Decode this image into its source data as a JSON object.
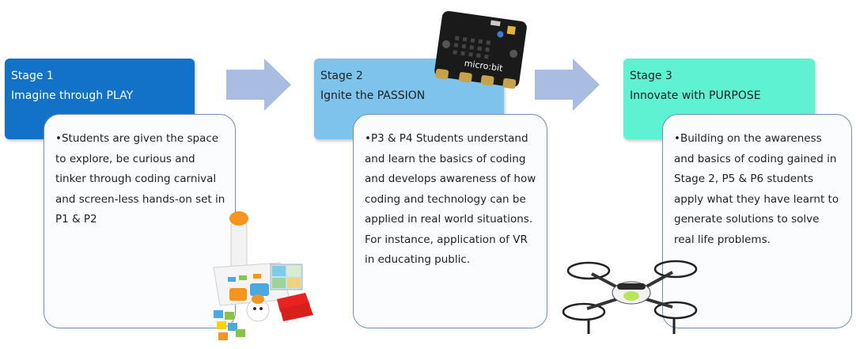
{
  "stages": [
    {
      "title": "Stage 1",
      "subtitle": "Imagine through PLAY",
      "header_color": "#1172c8",
      "body": "•Students are given the space to explore, be curious and tinker through coding carnival and screen-less hands-on set in P1 & P2"
    },
    {
      "title": "Stage 2",
      "subtitle": "Ignite the PASSION",
      "header_color": "#7ec3ec",
      "body": "•P3 & P4 Students understand and learn the basics of coding and develops awareness of how coding and technology can be applied in real world situations. For instance, application of VR in educating public."
    },
    {
      "title": "Stage 3",
      "subtitle": "Innovate with PURPOSE",
      "header_color": "#5ef1d2",
      "body": "•Building on the awareness and basics of coding gained in Stage 2, P5 & P6 students apply what they have learnt to generate solutions to solve real life problems."
    }
  ],
  "microbit": {
    "brand_label": "micro:bit"
  },
  "icons": [
    "arrow-right-icon",
    "microbit-board-icon",
    "coding-toy-kit-icon",
    "drone-icon"
  ]
}
